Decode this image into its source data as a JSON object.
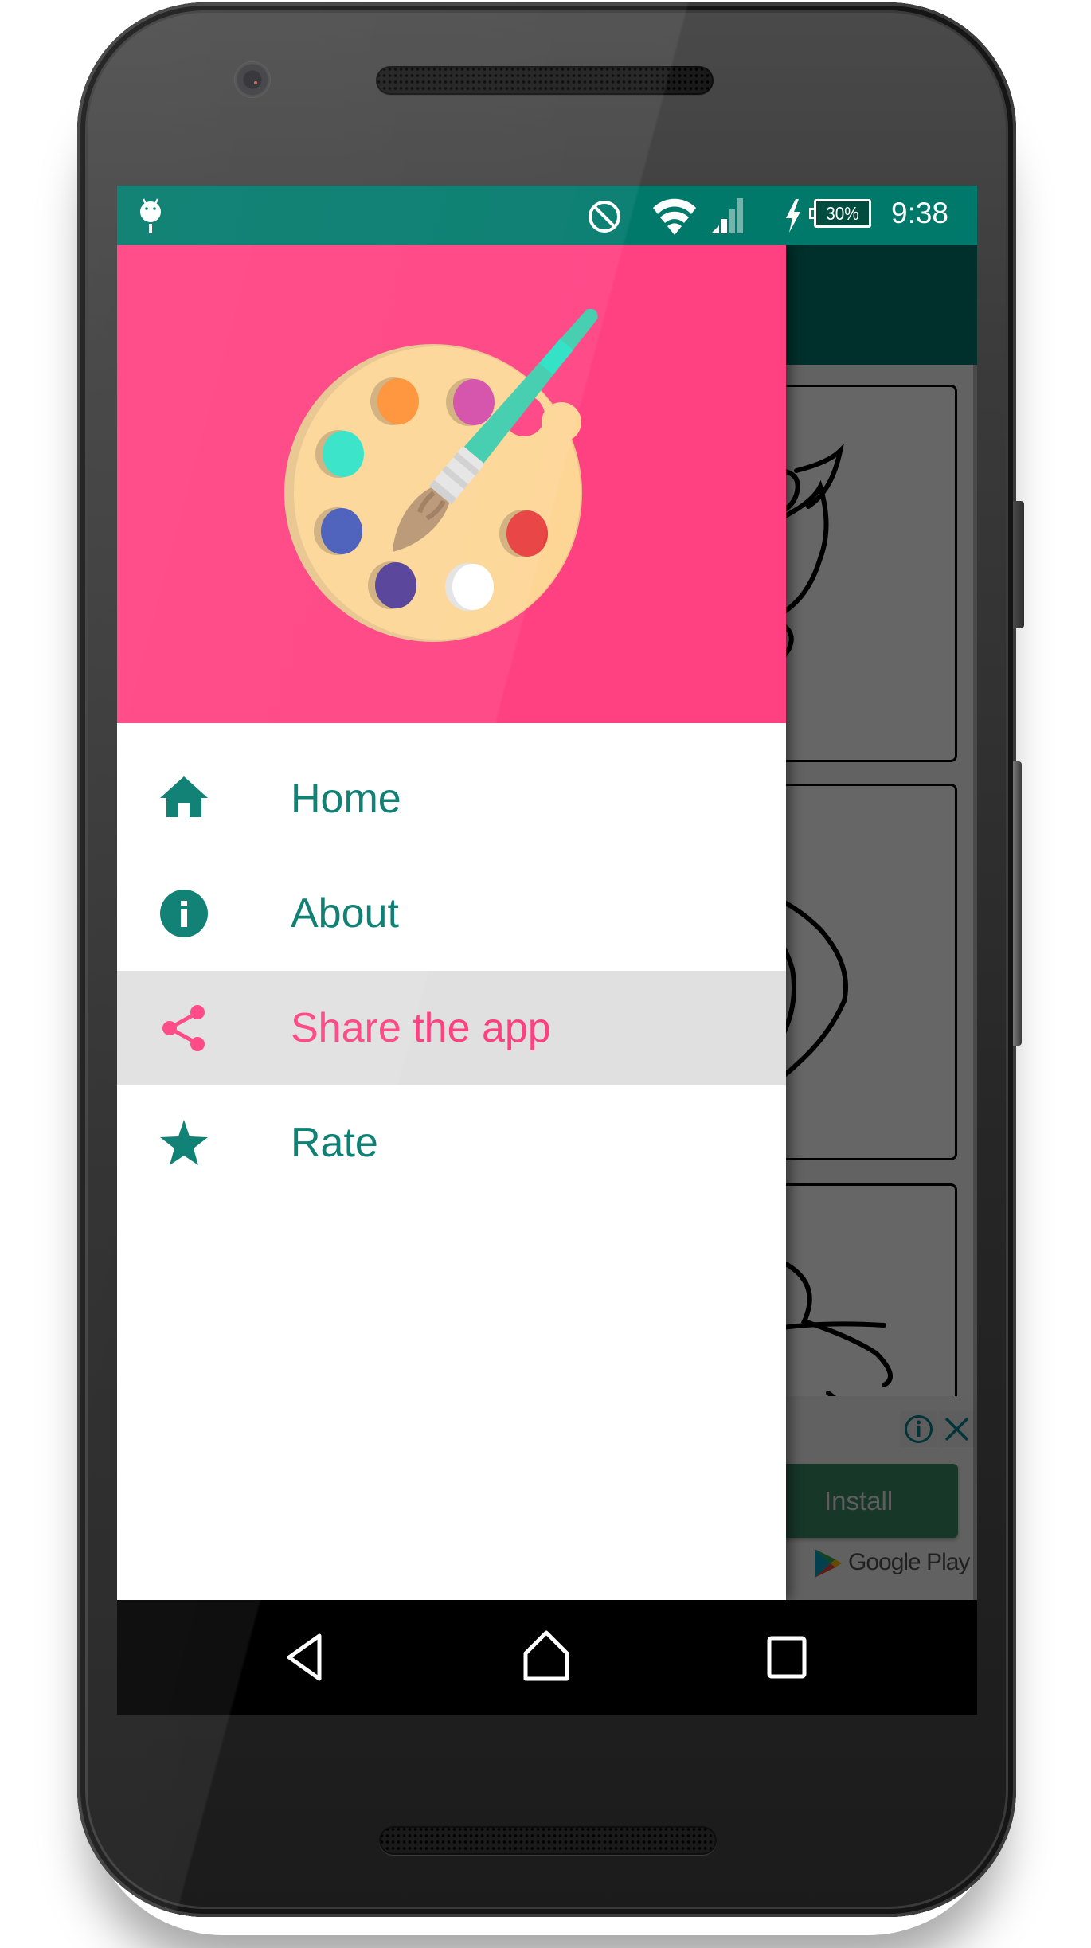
{
  "device": {
    "frame": "android-phone"
  },
  "status_bar": {
    "left_icons": [
      "android-debug-icon"
    ],
    "right_icons": [
      "do-not-disturb-icon",
      "wifi-icon",
      "cellular-signal-icon",
      "charging-bolt-icon",
      "battery-icon"
    ],
    "battery_percent": "30%",
    "battery_level": 0.3,
    "charging": true,
    "time": "9:38",
    "background_color": "#00796b"
  },
  "drawer": {
    "header": {
      "logo": "paint-palette-with-brush",
      "background_color": "#ff4081",
      "paint_colors": [
        "#ff8f33",
        "#d34ba8",
        "#2ee3c6",
        "#4458b8",
        "#e83b3b",
        "#503c96",
        "#ffffff"
      ]
    },
    "items": [
      {
        "icon": "home-icon",
        "label": "Home",
        "selected": false
      },
      {
        "icon": "info-icon",
        "label": "About",
        "selected": false
      },
      {
        "icon": "share-icon",
        "label": "Share the app",
        "selected": true
      },
      {
        "icon": "star-icon",
        "label": "Rate",
        "selected": false
      }
    ],
    "text_color": "#00796b",
    "selected_color": "#ff4081",
    "selected_background": "#e0e0e0"
  },
  "main_content": {
    "toolbar_color": "#00796b",
    "cards": [
      {
        "image": "flower-bouquet-line-art"
      },
      {
        "image": "rose-line-art"
      },
      {
        "image": "lily-line-art"
      }
    ],
    "scrim_opacity": 0.6
  },
  "ad_banner": {
    "install_label": "Install",
    "store_label": "Google Play",
    "icons": [
      "ad-info-icon",
      "ad-close-icon",
      "google-play-icon"
    ]
  },
  "nav_bar": {
    "buttons": [
      "back",
      "home",
      "recents"
    ]
  }
}
